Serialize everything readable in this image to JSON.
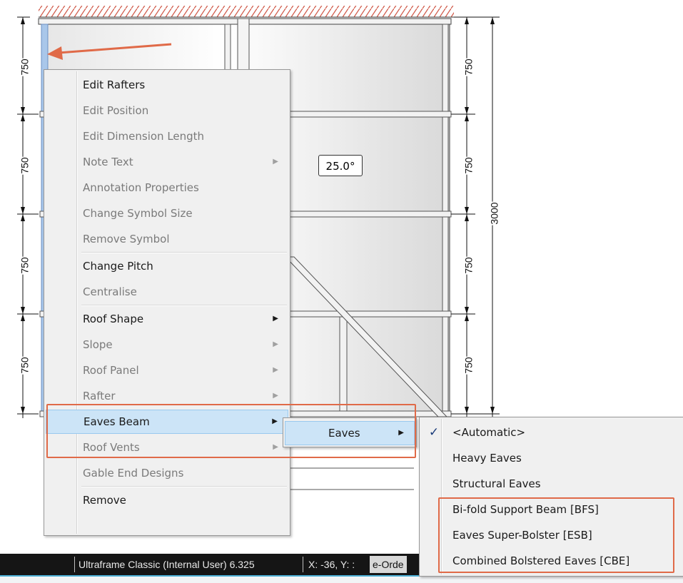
{
  "colors": {
    "highlight_box": "#e06a48",
    "menu_bg": "#f0f0f0",
    "selected_bg": "#cce4f7",
    "disabled_text": "#7a7a7a",
    "statusbar_bg": "#151515"
  },
  "drawing": {
    "dim_left": [
      "750",
      "750",
      "750",
      "750"
    ],
    "dim_right": [
      "750",
      "750",
      "750",
      "750"
    ],
    "dim_total": "3000",
    "pitch_label": "25.0°"
  },
  "context_menu": {
    "items": [
      {
        "label": "Edit Rafters",
        "enabled": true,
        "submenu": false
      },
      {
        "label": "Edit Position",
        "enabled": false,
        "submenu": false
      },
      {
        "label": "Edit Dimension Length",
        "enabled": false,
        "submenu": false
      },
      {
        "label": "Note Text",
        "enabled": false,
        "submenu": true
      },
      {
        "label": "Annotation Properties",
        "enabled": false,
        "submenu": false
      },
      {
        "label": "Change Symbol Size",
        "enabled": false,
        "submenu": false
      },
      {
        "label": "Remove Symbol",
        "enabled": false,
        "submenu": false
      },
      {
        "label": "Change Pitch",
        "enabled": true,
        "submenu": false
      },
      {
        "label": "Centralise",
        "enabled": false,
        "submenu": false
      },
      {
        "label": "Roof Shape",
        "enabled": true,
        "submenu": true
      },
      {
        "label": "Slope",
        "enabled": false,
        "submenu": true
      },
      {
        "label": "Roof Panel",
        "enabled": false,
        "submenu": true
      },
      {
        "label": "Rafter",
        "enabled": false,
        "submenu": true
      },
      {
        "label": "Eaves Beam",
        "enabled": true,
        "submenu": true,
        "selected": true
      },
      {
        "label": "Roof Vents",
        "enabled": false,
        "submenu": true
      },
      {
        "label": "Gable End Designs",
        "enabled": false,
        "submenu": false
      },
      {
        "label": "Remove",
        "enabled": true,
        "submenu": false
      }
    ]
  },
  "submenu_eaves": {
    "label": "Eaves"
  },
  "submenu_options": {
    "items": [
      {
        "label": "<Automatic>",
        "checked": true
      },
      {
        "label": "Heavy Eaves",
        "checked": false
      },
      {
        "label": "Structural Eaves",
        "checked": false
      },
      {
        "label": "Bi-fold Support Beam [BFS]",
        "checked": false
      },
      {
        "label": "Eaves Super-Bolster [ESB]",
        "checked": false
      },
      {
        "label": "Combined Bolstered Eaves [CBE]",
        "checked": false
      }
    ],
    "check_icon": "check-icon"
  },
  "statusbar": {
    "app": "Ultraframe Classic (Internal User) 6.325",
    "coords": "X: -36, Y: :",
    "order": "e-Orde"
  }
}
